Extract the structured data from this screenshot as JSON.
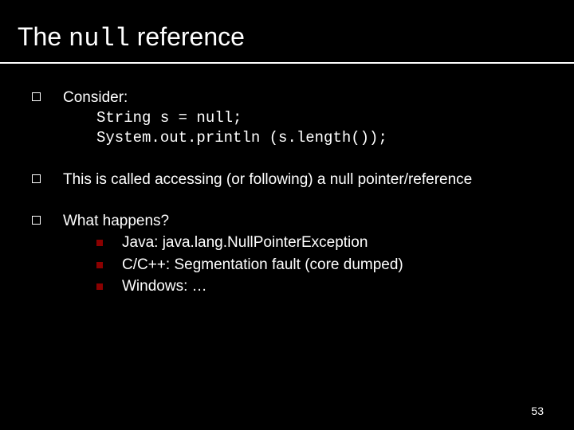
{
  "title": {
    "prefix": "The ",
    "mono": "null",
    "suffix": " reference"
  },
  "items": [
    {
      "lead": "Consider:",
      "code": [
        "String s = null;",
        "System.out.println (s.length());"
      ]
    },
    {
      "lead": "This is called accessing (or following) a null pointer/reference"
    },
    {
      "lead": "What happens?",
      "subs": [
        "Java: java.lang.NullPointerException",
        "C/C++: Segmentation fault (core dumped)",
        "Windows: …"
      ]
    }
  ],
  "page_number": "53"
}
